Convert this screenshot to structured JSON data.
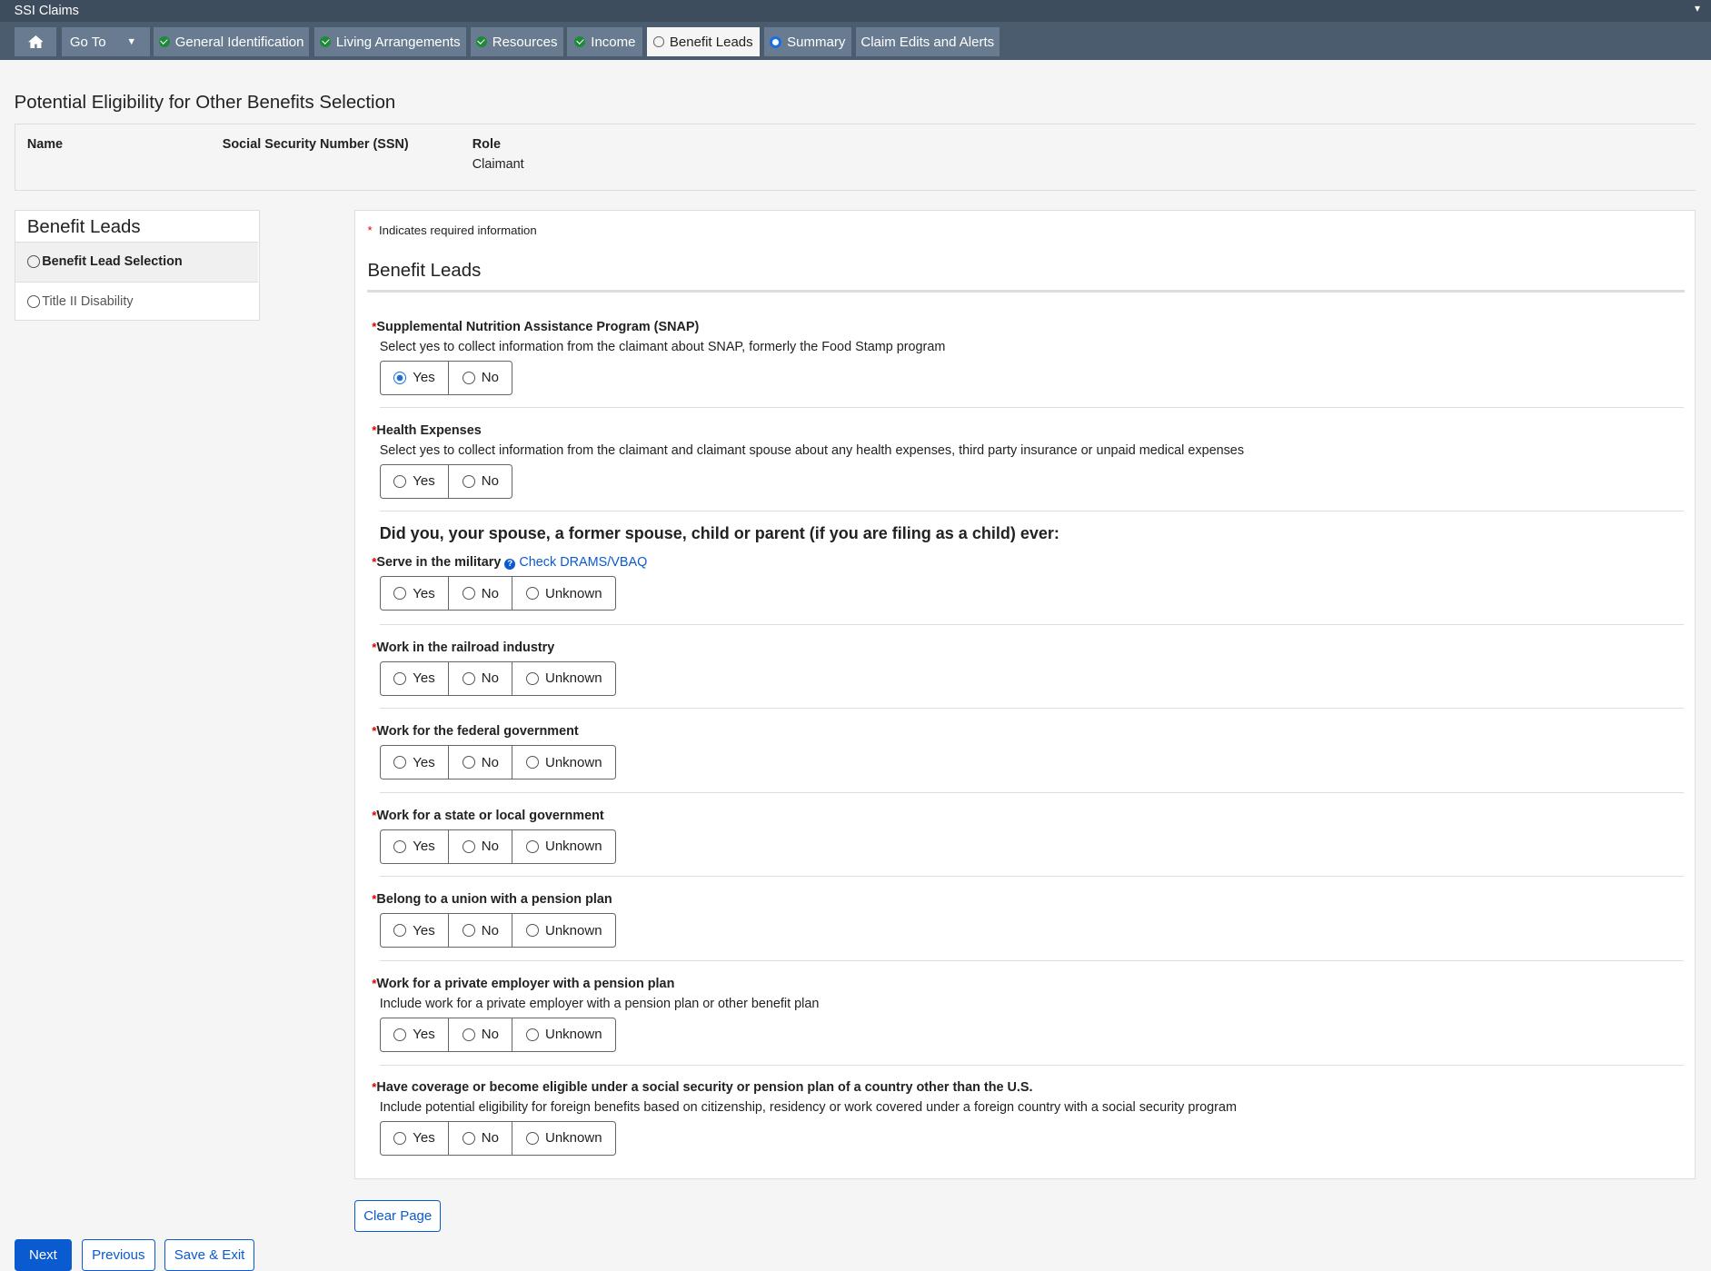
{
  "app": {
    "title": "SSI Claims"
  },
  "nav": {
    "goto_label": "Go To",
    "tabs": [
      {
        "label": "General Identification",
        "status": "complete"
      },
      {
        "label": "Living Arrangements",
        "status": "complete"
      },
      {
        "label": "Resources",
        "status": "complete"
      },
      {
        "label": "Income",
        "status": "complete"
      },
      {
        "label": "Benefit Leads",
        "status": "current"
      },
      {
        "label": "Summary",
        "status": "in-progress"
      },
      {
        "label": "Claim Edits and Alerts",
        "status": "none"
      }
    ]
  },
  "page": {
    "title": "Potential Eligibility for Other Benefits Selection",
    "info": {
      "name_label": "Name",
      "ssn_label": "Social Security Number (SSN)",
      "role_label": "Role",
      "role_value": "Claimant"
    }
  },
  "sidebar": {
    "header": "Benefit Leads",
    "items": [
      {
        "label": "Benefit Lead Selection"
      },
      {
        "label": "Title II Disability"
      }
    ]
  },
  "form": {
    "required_note": "Indicates required information",
    "section_title": "Benefit Leads",
    "group_heading": "Did you, your spouse, a former spouse, child or parent (if you are filing as a child) ever:",
    "link_label": "Check DRAMS/VBAQ",
    "questions": [
      {
        "label": "Supplemental Nutrition Assistance Program (SNAP)",
        "desc": "Select yes to collect information from the claimant about SNAP, formerly the Food Stamp program",
        "options": [
          "Yes",
          "No"
        ],
        "selected": "Yes"
      },
      {
        "label": "Health Expenses",
        "desc": "Select yes to collect information from the claimant and claimant spouse about any health expenses, third party insurance or unpaid medical expenses",
        "options": [
          "Yes",
          "No"
        ],
        "selected": null
      },
      {
        "label": "Serve in the military",
        "desc": null,
        "options": [
          "Yes",
          "No",
          "Unknown"
        ],
        "selected": null
      },
      {
        "label": "Work in the railroad industry",
        "desc": null,
        "options": [
          "Yes",
          "No",
          "Unknown"
        ],
        "selected": null
      },
      {
        "label": "Work for the federal government",
        "desc": null,
        "options": [
          "Yes",
          "No",
          "Unknown"
        ],
        "selected": null
      },
      {
        "label": "Work for a state or local government",
        "desc": null,
        "options": [
          "Yes",
          "No",
          "Unknown"
        ],
        "selected": null
      },
      {
        "label": "Belong to a union with a pension plan",
        "desc": null,
        "options": [
          "Yes",
          "No",
          "Unknown"
        ],
        "selected": null
      },
      {
        "label": "Work for a private employer with a pension plan",
        "desc": "Include work for a private employer with a pension plan or other benefit plan",
        "options": [
          "Yes",
          "No",
          "Unknown"
        ],
        "selected": null
      },
      {
        "label": "Have coverage or become eligible under a social security or pension plan of a country other than the U.S.",
        "desc": "Include potential eligibility for foreign benefits based on citizenship, residency or work covered under a foreign country with a social security program",
        "options": [
          "Yes",
          "No",
          "Unknown"
        ],
        "selected": null
      }
    ]
  },
  "buttons": {
    "clear": "Clear Page",
    "next": "Next",
    "previous": "Previous",
    "save_exit": "Save & Exit"
  }
}
